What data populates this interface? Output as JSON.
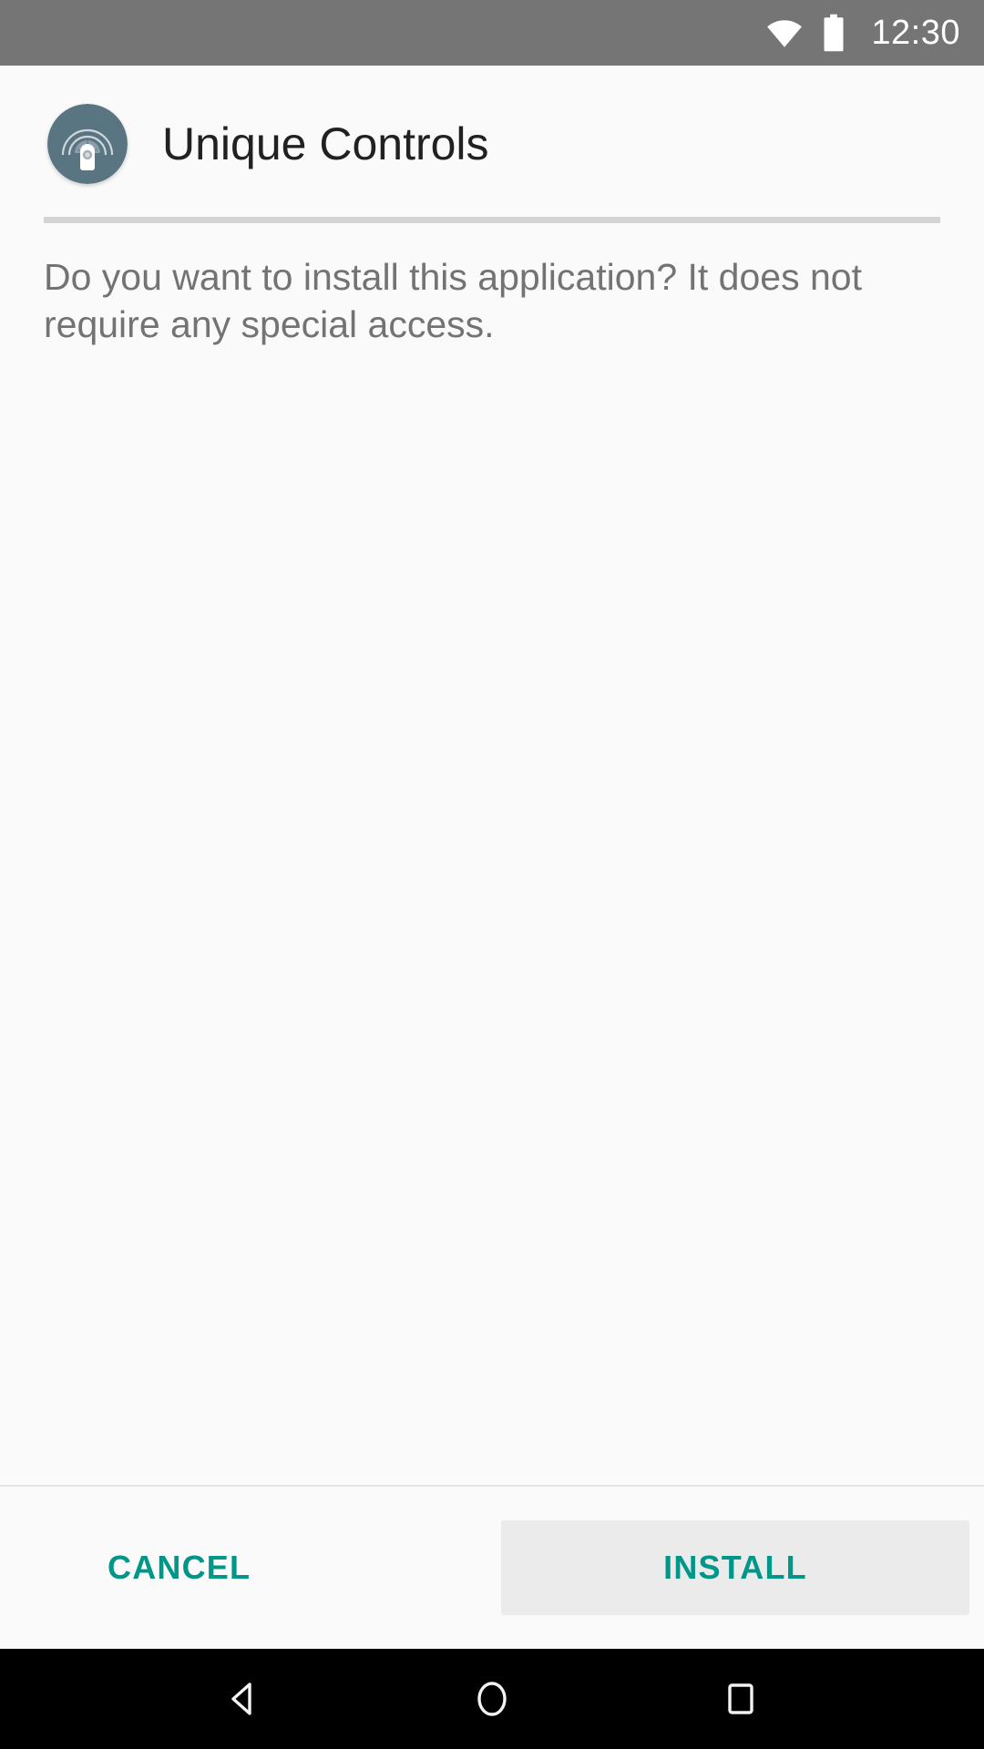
{
  "status_bar": {
    "time": "12:30",
    "icons": [
      "wifi-icon",
      "battery-icon"
    ],
    "background_color": "#757575",
    "foreground_color": "#ffffff"
  },
  "header": {
    "app_name": "Unique Controls",
    "app_icon": "broadcast-lock-icon",
    "icon_background_color": "#5a7582",
    "title_color": "#212121"
  },
  "divider": {
    "color": "#d4d4d4"
  },
  "main": {
    "message": "Do you want to install this application? It does not require any special access.",
    "message_color": "#737373",
    "background_color": "#fafafa"
  },
  "actions": {
    "cancel_label": "CANCEL",
    "install_label": "INSTALL",
    "accent_color": "#009688",
    "install_background_color": "#ebebeb"
  },
  "nav_bar": {
    "background_color": "#000000",
    "buttons": [
      {
        "name": "back-icon",
        "label": "Back"
      },
      {
        "name": "home-icon",
        "label": "Home"
      },
      {
        "name": "recents-icon",
        "label": "Recents"
      }
    ]
  }
}
